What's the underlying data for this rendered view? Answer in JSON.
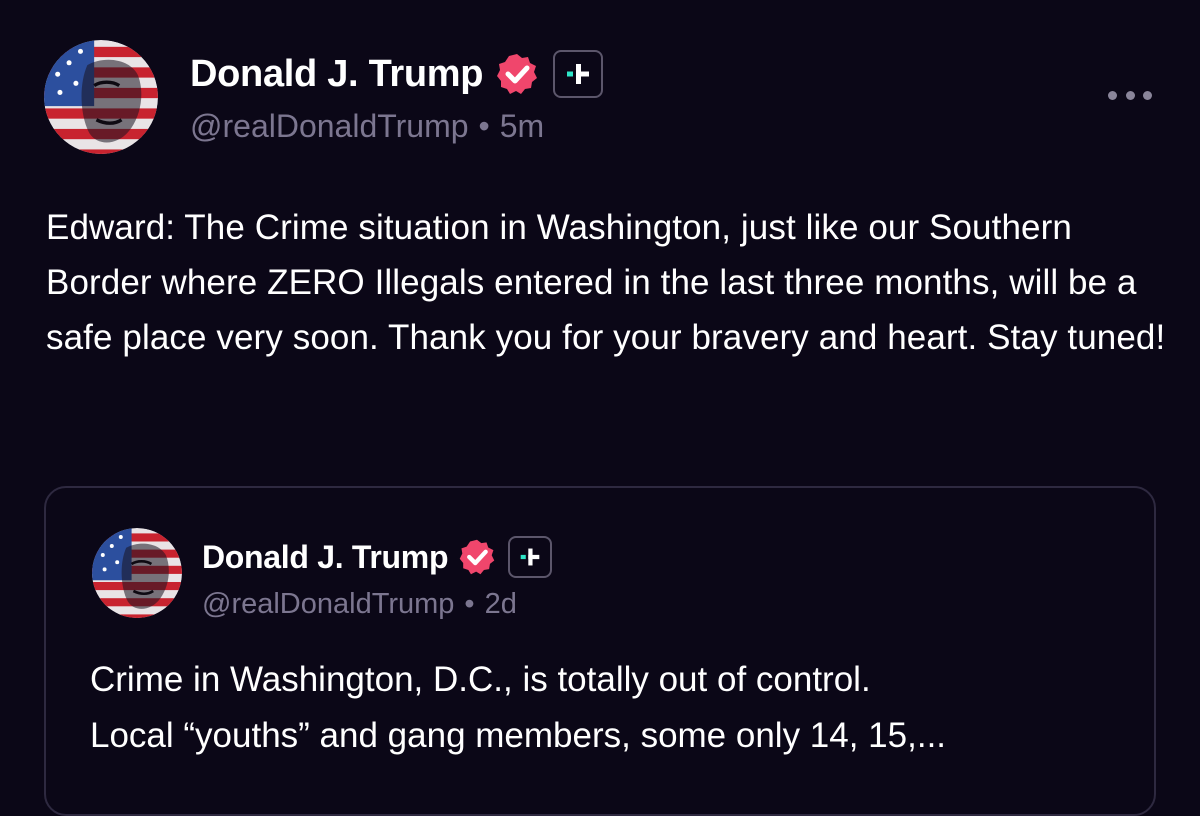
{
  "post": {
    "author_name": "Donald J. Trump",
    "handle": "@realDonaldTrump",
    "separator": "•",
    "time": "5m",
    "verified_icon": "verified-badge-icon",
    "plus_icon": "plus-badge-icon",
    "more_icon": "more-options-icon",
    "text": "Edward: The Crime situation in Washington, just like our Southern Border where ZERO Illegals entered in the last three months, will be a safe place very soon. Thank you for your bravery and heart. Stay tuned!"
  },
  "quoted_post": {
    "author_name": "Donald J. Trump",
    "handle": "@realDonaldTrump",
    "separator": "•",
    "time": "2d",
    "line1": "Crime in Washington, D.C., is totally out of control.",
    "line2": "Local “youths” and gang members, some only 14, 15,..."
  },
  "colors": {
    "background": "#0b0717",
    "text": "#ffffff",
    "muted": "#7c7690",
    "verified": "#f0466c",
    "plus_accent": "#2ee6c8",
    "card_border": "#2e2940"
  }
}
